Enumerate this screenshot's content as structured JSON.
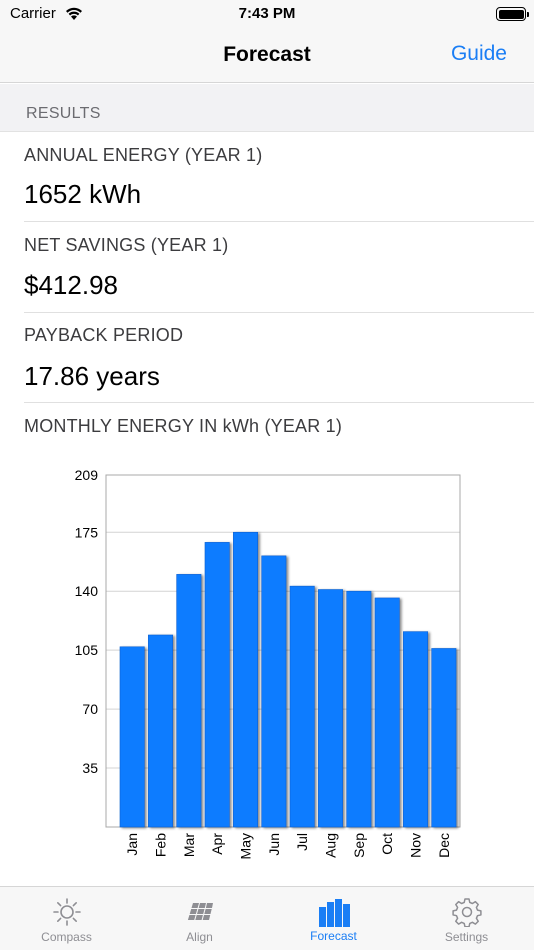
{
  "status": {
    "carrier": "Carrier",
    "time": "7:43 PM"
  },
  "nav": {
    "title": "Forecast",
    "guide_label": "Guide"
  },
  "results": {
    "header": "RESULTS",
    "annual_energy_label": "ANNUAL ENERGY (YEAR 1)",
    "annual_energy_value": "1652 kWh",
    "net_savings_label": "NET SAVINGS (YEAR 1)",
    "net_savings_value": "$412.98",
    "payback_label": "PAYBACK PERIOD",
    "payback_value": "17.86 years",
    "monthly_label": "MONTHLY ENERGY IN kWh (YEAR 1)"
  },
  "chart_data": {
    "type": "bar",
    "categories": [
      "Jan",
      "Feb",
      "Mar",
      "Apr",
      "May",
      "Jun",
      "Jul",
      "Aug",
      "Sep",
      "Oct",
      "Nov",
      "Dec"
    ],
    "values": [
      107,
      114,
      150,
      169,
      175,
      161,
      143,
      141,
      140,
      136,
      116,
      106
    ],
    "yticks": [
      "209",
      "175",
      "140",
      "105",
      "70",
      "35"
    ],
    "ylim": [
      0,
      209
    ],
    "bar_color": "#0a7cff",
    "grid": true
  },
  "tabs": [
    {
      "label": "Compass",
      "icon": "sun-icon",
      "active": false
    },
    {
      "label": "Align",
      "icon": "solar-panel-icon",
      "active": false
    },
    {
      "label": "Forecast",
      "icon": "bar-chart-icon",
      "active": true
    },
    {
      "label": "Settings",
      "icon": "gear-icon",
      "active": false
    }
  ],
  "colors": {
    "accent": "#1a7ef5",
    "inactive": "#8e8e93"
  }
}
